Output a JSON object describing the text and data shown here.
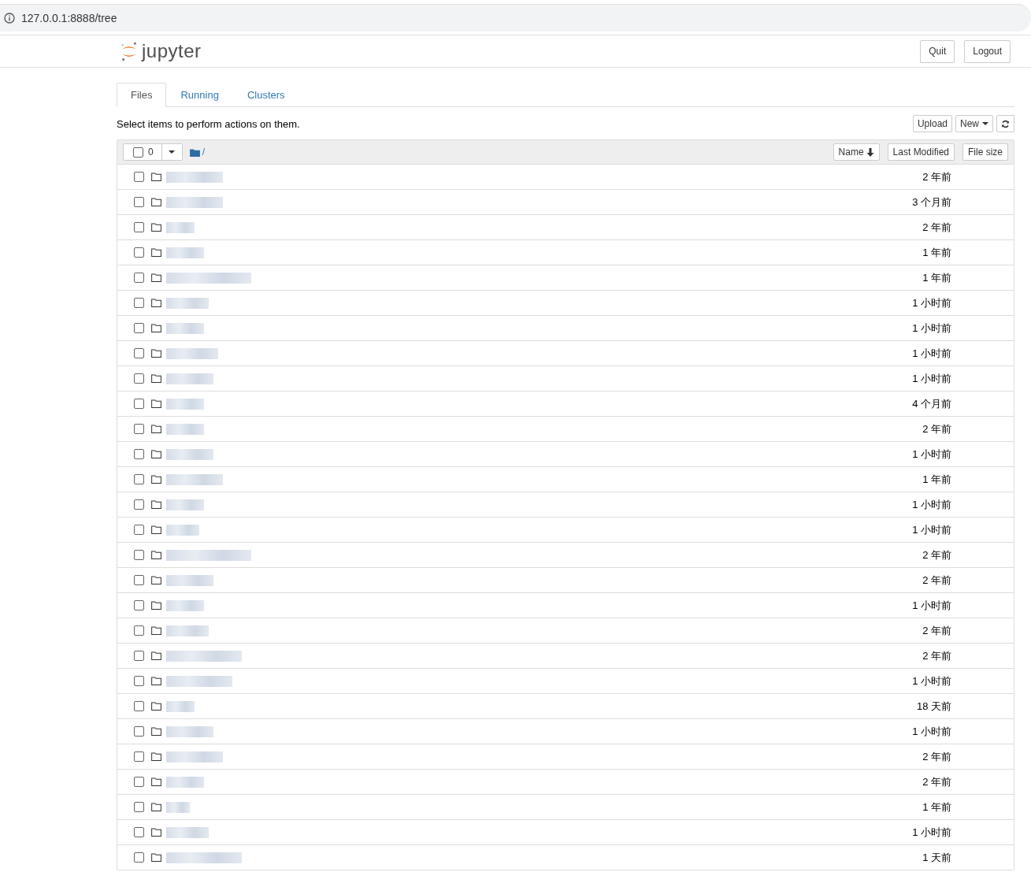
{
  "address_bar": {
    "url": "127.0.0.1:8888/tree"
  },
  "header": {
    "logo_text": "jupyter",
    "buttons": [
      "Quit",
      "Logout"
    ]
  },
  "tabs": [
    {
      "label": "Files",
      "selected": true
    },
    {
      "label": "Running",
      "selected": false
    },
    {
      "label": "Clusters",
      "selected": false
    }
  ],
  "toolbar": {
    "hint": "Select items to perform actions on them.",
    "buttons": [
      {
        "kind": "text",
        "label": "Upload"
      },
      {
        "kind": "dropdown",
        "label": "New"
      },
      {
        "kind": "refresh"
      }
    ]
  },
  "list_header": {
    "select_all": {
      "checked": false,
      "count": "0"
    },
    "path": "/",
    "sort_buttons": [
      {
        "label": "Name",
        "sorted": true
      },
      {
        "label": "Last Modified",
        "sorted": false
      },
      {
        "label": "File size",
        "sorted": false
      }
    ]
  },
  "rows": [
    {
      "checked": false,
      "modified": "2 年前"
    },
    {
      "checked": false,
      "modified": "3 个月前"
    },
    {
      "checked": false,
      "modified": "2 年前"
    },
    {
      "checked": false,
      "modified": "1 年前"
    },
    {
      "checked": false,
      "modified": "1 年前"
    },
    {
      "checked": false,
      "modified": "1 小时前"
    },
    {
      "checked": false,
      "modified": "1 小时前"
    },
    {
      "checked": false,
      "modified": "1 小时前"
    },
    {
      "checked": false,
      "modified": "1 小时前"
    },
    {
      "checked": false,
      "modified": "4 个月前"
    },
    {
      "checked": false,
      "modified": "2 年前"
    },
    {
      "checked": false,
      "modified": "1 小时前"
    },
    {
      "checked": false,
      "modified": "1 年前"
    },
    {
      "checked": false,
      "modified": "1 小时前"
    },
    {
      "checked": false,
      "modified": "1 小时前"
    },
    {
      "checked": false,
      "modified": "2 年前"
    },
    {
      "checked": false,
      "modified": "2 年前"
    },
    {
      "checked": false,
      "modified": "1 小时前"
    },
    {
      "checked": false,
      "modified": "2 年前"
    },
    {
      "checked": false,
      "modified": "2 年前"
    },
    {
      "checked": false,
      "modified": "1 小时前"
    },
    {
      "checked": false,
      "modified": "18 天前"
    },
    {
      "checked": false,
      "modified": "1 小时前"
    },
    {
      "checked": false,
      "modified": "2 年前"
    },
    {
      "checked": false,
      "modified": "2 年前"
    },
    {
      "checked": false,
      "modified": "1 年前"
    },
    {
      "checked": false,
      "modified": "1 小时前"
    },
    {
      "checked": false,
      "modified": "1 天前"
    }
  ]
}
